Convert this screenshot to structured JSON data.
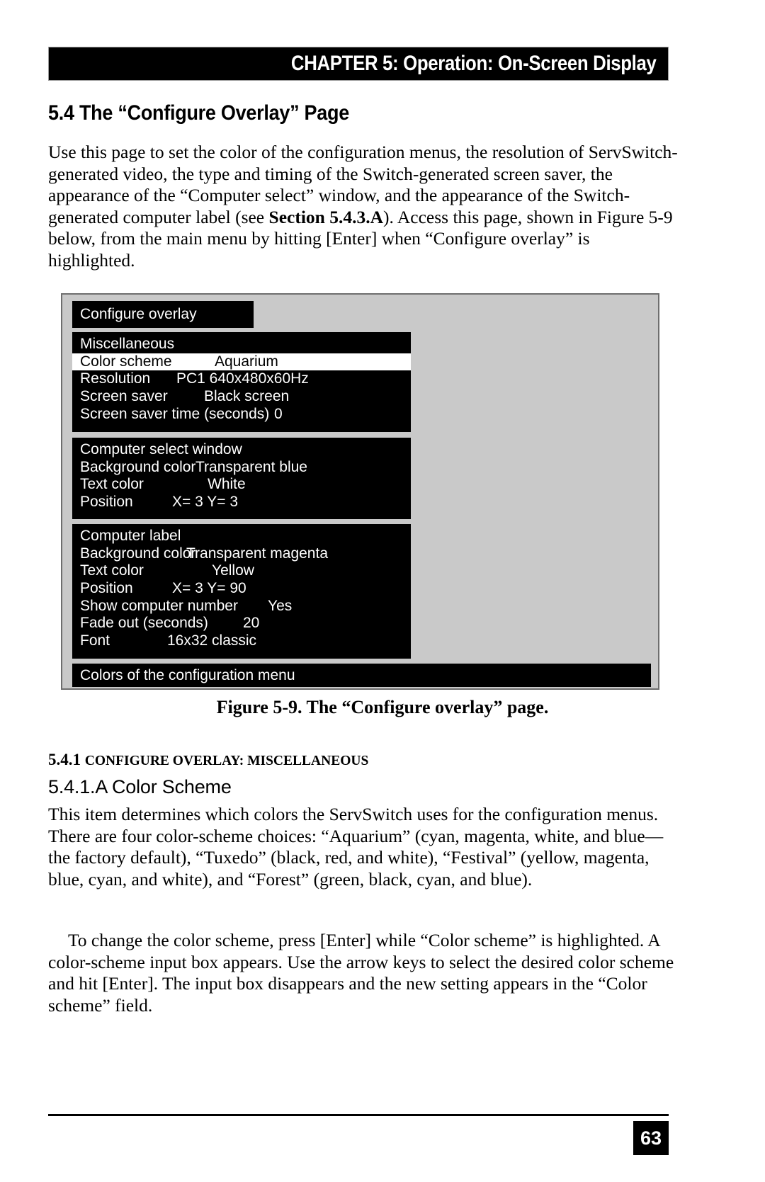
{
  "header": {
    "title": "CHAPTER 5: Operation: On-Screen Display"
  },
  "section": {
    "heading": "5.4 The “Configure Overlay” Page",
    "intro_before_bold": "Use this page to set the color of the configuration menus, the resolution of ServSwitch-generated video, the type and timing of the Switch-generated screen saver, the appearance of the “Computer select” window, and the appearance of the Switch-generated computer label (see ",
    "intro_bold": "Section 5.4.3.A",
    "intro_after_bold": "). Access this page, shown in Figure 5-9 below, from the main menu by hitting [Enter] when “Configure overlay” is highlighted."
  },
  "figure": {
    "caption": "Figure 5-9. The “Configure overlay” page.",
    "osd": {
      "title": "Configure overlay",
      "panels": [
        {
          "name": "miscellaneous",
          "rows": [
            {
              "label": "Miscellaneous",
              "value": "",
              "selected": false,
              "label_width": 0
            },
            {
              "label": "Color scheme",
              "value": "Aquarium",
              "selected": true,
              "label_width": 190
            },
            {
              "label": "Resolution",
              "value": "PC1 640x480x60Hz",
              "selected": false,
              "label_width": 136
            },
            {
              "label": "Screen saver",
              "value": "Black screen",
              "selected": false,
              "label_width": 175
            },
            {
              "label": "Screen saver time (seconds)",
              "value": "0",
              "selected": false,
              "label_width": 274
            }
          ]
        },
        {
          "name": "computer-select-window",
          "rows": [
            {
              "label": "Computer select window",
              "value": "",
              "selected": false,
              "label_width": 0
            },
            {
              "label": "Background color",
              "value": "Transparent blue",
              "selected": false,
              "label_width": 163
            },
            {
              "label": "Text color",
              "value": "White",
              "selected": false,
              "label_width": 180
            },
            {
              "label": "Position",
              "value": "X=  3   Y=  3",
              "selected": false,
              "label_width": 130
            }
          ]
        },
        {
          "name": "computer-label",
          "rows": [
            {
              "label": "Computer label",
              "value": "",
              "selected": false,
              "label_width": 0
            },
            {
              "label": "Background color",
              "value": "Transparent magenta",
              "selected": false,
              "label_width": 150
            },
            {
              "label": "Text color",
              "value": "Yellow",
              "selected": false,
              "label_width": 186
            },
            {
              "label": "Position",
              "value": "X=  3   Y= 90",
              "selected": false,
              "label_width": 130
            },
            {
              "label": "Show computer number",
              "value": "Yes",
              "selected": false,
              "label_width": 265
            },
            {
              "label": "Fade out (seconds)",
              "value": "20",
              "selected": false,
              "label_width": 230
            },
            {
              "label": "Font",
              "value": "16x32 classic",
              "selected": false,
              "label_width": 123
            }
          ]
        }
      ],
      "footer_bar": "Colors of the configuration menu"
    }
  },
  "subsections": {
    "smallcaps_number": "5.4.1 ",
    "smallcaps_title": "Configure Overlay: Miscellaneous",
    "sans_heading": "5.4.1.A Color Scheme",
    "para_1": "This item determines which colors the ServSwitch uses for the configuration menus. There are four color-scheme choices: “Aquarium” (cyan, magenta, white, and blue—the factory default), “Tuxedo” (black, red, and white), “Festival” (yellow, magenta, blue, cyan, and white), and “Forest” (green, black, cyan, and blue).",
    "para_2": "To change the color scheme, press [Enter] while “Color scheme” is highlighted. A color-scheme input box appears. Use the arrow keys to select the desired color scheme and hit [Enter]. The input box disappears and the new setting appears in the “Color scheme” field."
  },
  "footer": {
    "page_number": "63"
  }
}
